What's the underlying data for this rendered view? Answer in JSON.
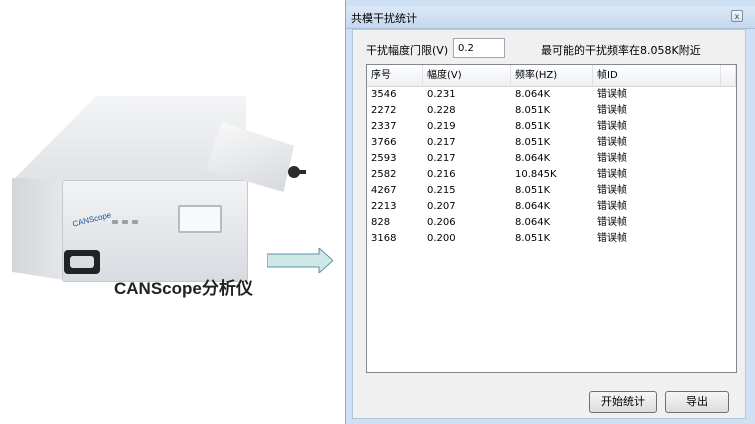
{
  "left": {
    "device_brand": "CANScope",
    "caption": "CANScope分析仪"
  },
  "dialog": {
    "title": "共模干扰统计",
    "close_symbol": "x",
    "threshold_label": "干扰幅度门限(V)",
    "threshold_value": "0.2",
    "freq_text": "最可能的干扰频率在8.058K附近",
    "columns": [
      "序号",
      "幅度(V)",
      "频率(HZ)",
      "帧ID",
      ""
    ],
    "rows": [
      [
        "3546",
        "0.231",
        "8.064K",
        "错误帧"
      ],
      [
        "2272",
        "0.228",
        "8.051K",
        "错误帧"
      ],
      [
        "2337",
        "0.219",
        "8.051K",
        "错误帧"
      ],
      [
        "3766",
        "0.217",
        "8.051K",
        "错误帧"
      ],
      [
        "2593",
        "0.217",
        "8.064K",
        "错误帧"
      ],
      [
        "2582",
        "0.216",
        "10.845K",
        "错误帧"
      ],
      [
        "4267",
        "0.215",
        "8.051K",
        "错误帧"
      ],
      [
        "2213",
        "0.207",
        "8.064K",
        "错误帧"
      ],
      [
        "828",
        "0.206",
        "8.064K",
        "错误帧"
      ],
      [
        "3168",
        "0.200",
        "8.051K",
        "错误帧"
      ]
    ],
    "start_button": "开始统计",
    "export_button": "导出"
  }
}
